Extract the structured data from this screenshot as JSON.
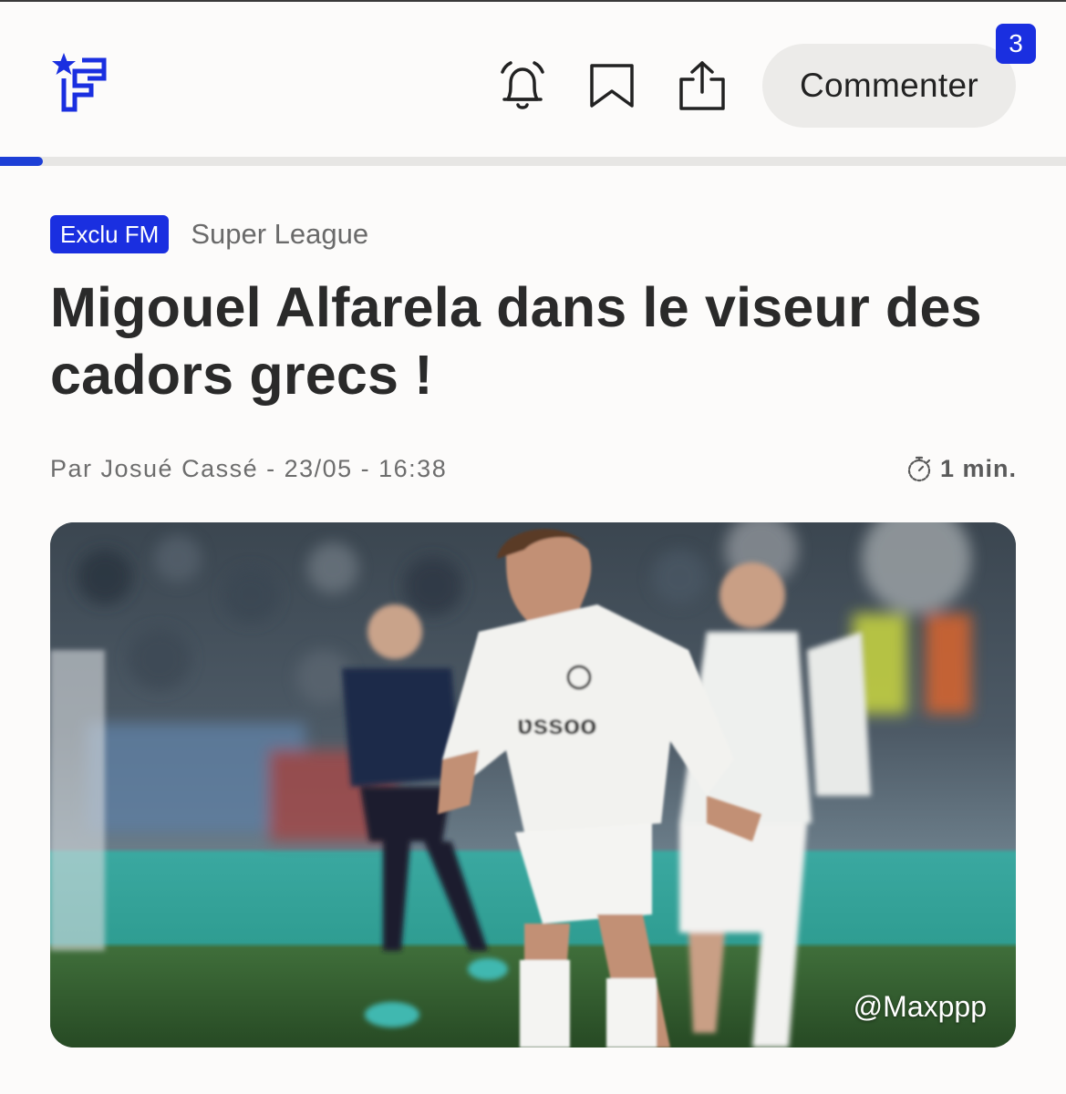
{
  "header": {
    "logo_icon": "footmercato-logo-icon",
    "notifications_icon": "bell-icon",
    "bookmark_icon": "bookmark-icon",
    "share_icon": "share-icon",
    "comment_label": "Commenter",
    "comment_count": "3",
    "accent_color": "#1a2fe0"
  },
  "progress": {
    "read_fraction": 0.04
  },
  "article": {
    "tags": {
      "exclusive": "Exclu FM",
      "category": "Super League"
    },
    "title": "Migouel Alfarela dans le viseur des cadors grecs !",
    "byline": "Par Josué Cassé - 23/05 - 16:38",
    "read_time": "1 min.",
    "read_time_icon": "stopwatch-icon",
    "image": {
      "description_icon": "football-players-photo",
      "credit": "@Maxppp"
    }
  }
}
